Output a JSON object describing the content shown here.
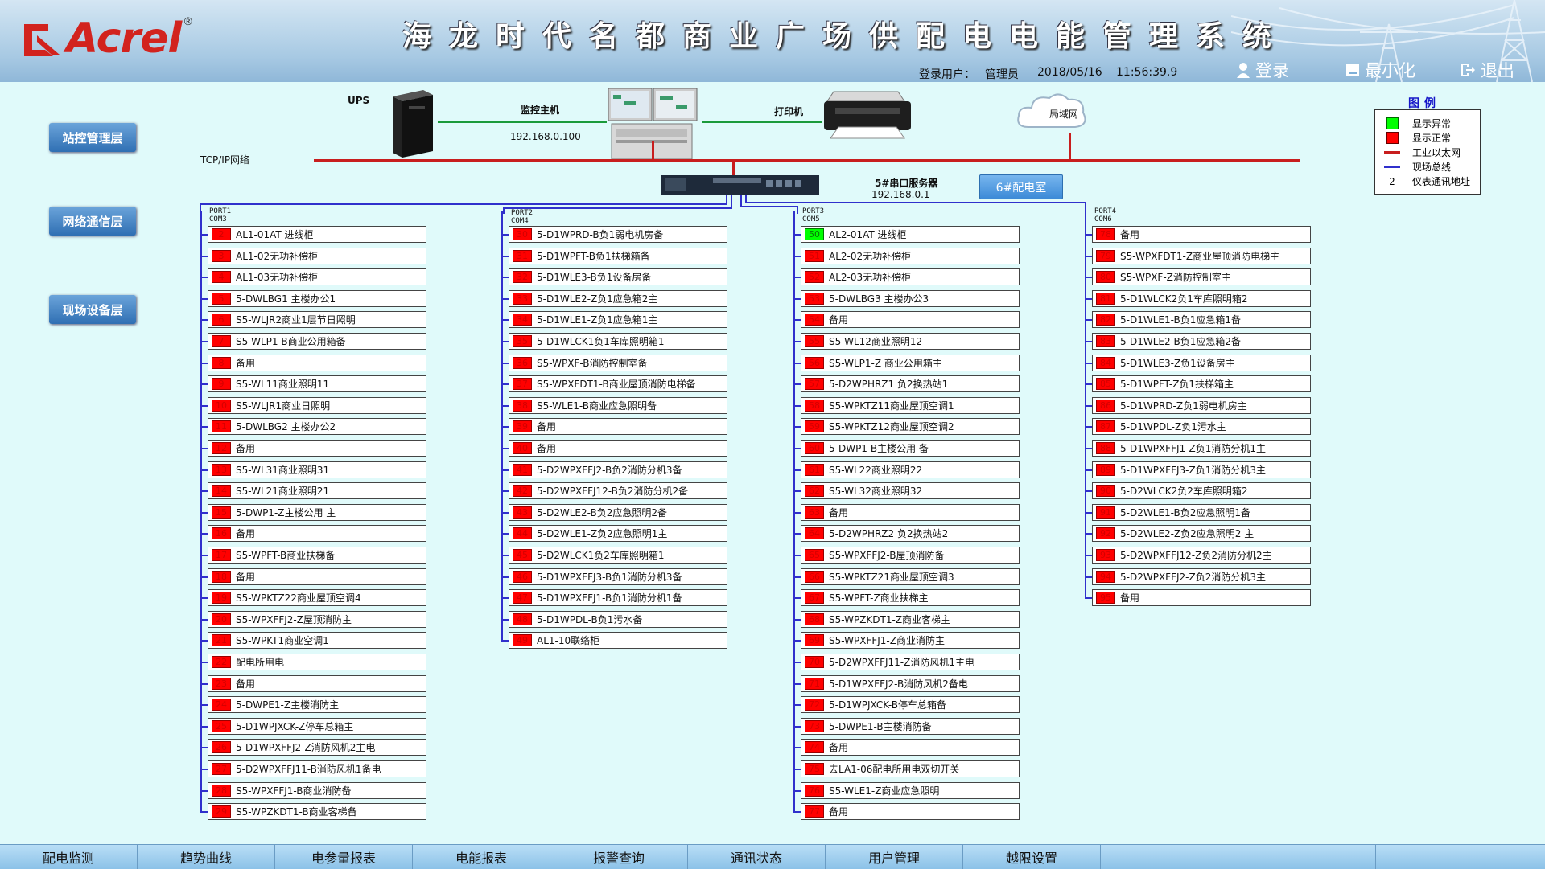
{
  "header": {
    "brand": "Acrel",
    "reg_mark": "®",
    "title": "海龙时代名都商业广场供配电电能管理系统",
    "login_label": "登录用户：",
    "user": "管理员",
    "date": "2018/05/16",
    "time": "11:56:39.9",
    "login_btn": "登录",
    "minimize_btn": "最小化",
    "exit_btn": "退出"
  },
  "layers": [
    "站控管理层",
    "网络通信层",
    "现场设备层"
  ],
  "network": {
    "ups": "UPS",
    "host_label": "监控主机",
    "host_ip": "192.168.0.100",
    "printer": "打印机",
    "lan": "局域网",
    "tcp": "TCP/IP网络",
    "server_name": "5#串口服务器",
    "server_ip": "192.168.0.1",
    "room_btn": "6#配电室"
  },
  "legend": {
    "title": "图例",
    "items": [
      {
        "label": "显示异常",
        "icon": "green-square",
        "color": "#00ff00"
      },
      {
        "label": "显示正常",
        "icon": "red-square",
        "color": "#ff0000"
      },
      {
        "label": "工业以太网",
        "icon": "red-line",
        "color": "#c81e1e"
      },
      {
        "label": "现场总线",
        "icon": "blue-line",
        "color": "#3030cc"
      },
      {
        "label": "仪表通讯地址",
        "icon": "number",
        "symbol": "2"
      }
    ]
  },
  "ports": [
    {
      "port": "PORT1",
      "com": "COM3",
      "devices": [
        {
          "num": "2",
          "name": "AL1-01AT 进线柜"
        },
        {
          "num": "3",
          "name": "AL1-02无功补偿柜"
        },
        {
          "num": "4",
          "name": "AL1-03无功补偿柜"
        },
        {
          "num": "5",
          "name": "5-DWLBG1 主楼办公1"
        },
        {
          "num": "6",
          "name": "S5-WLJR2商业1层节日照明"
        },
        {
          "num": "7",
          "name": "S5-WLP1-B商业公用箱备"
        },
        {
          "num": "8",
          "name": "备用"
        },
        {
          "num": "9",
          "name": "S5-WL11商业照明11"
        },
        {
          "num": "10",
          "name": "S5-WLJR1商业日照明"
        },
        {
          "num": "11",
          "name": "5-DWLBG2 主楼办公2"
        },
        {
          "num": "12",
          "name": "备用"
        },
        {
          "num": "13",
          "name": "S5-WL31商业照明31"
        },
        {
          "num": "14",
          "name": "S5-WL21商业照明21"
        },
        {
          "num": "15",
          "name": "5-DWP1-Z主楼公用 主"
        },
        {
          "num": "16",
          "name": "备用"
        },
        {
          "num": "17",
          "name": "S5-WPFT-B商业扶梯备"
        },
        {
          "num": "18",
          "name": "备用"
        },
        {
          "num": "19",
          "name": "S5-WPKTZ22商业屋顶空调4"
        },
        {
          "num": "20",
          "name": "S5-WPXFFJ2-Z屋顶消防主"
        },
        {
          "num": "21",
          "name": "S5-WPKT1商业空调1"
        },
        {
          "num": "22",
          "name": "配电所用电"
        },
        {
          "num": "23",
          "name": "备用"
        },
        {
          "num": "24",
          "name": "5-DWPE1-Z主楼消防主"
        },
        {
          "num": "25",
          "name": "5-D1WPJXCK-Z停车总箱主"
        },
        {
          "num": "26",
          "name": "5-D1WPXFFJ2-Z消防风机2主电"
        },
        {
          "num": "27",
          "name": "5-D2WPXFFJ11-B消防风机1备电"
        },
        {
          "num": "28",
          "name": "S5-WPXFFJ1-B商业消防备"
        },
        {
          "num": "29",
          "name": "S5-WPZKDT1-B商业客梯备"
        }
      ]
    },
    {
      "port": "PORT2",
      "com": "COM4",
      "devices": [
        {
          "num": "30",
          "name": "5-D1WPRD-B负1弱电机房备"
        },
        {
          "num": "31",
          "name": "5-D1WPFT-B负1扶梯箱备"
        },
        {
          "num": "32",
          "name": "5-D1WLE3-B负1设备房备"
        },
        {
          "num": "33",
          "name": "5-D1WLE2-Z负1应急箱2主"
        },
        {
          "num": "34",
          "name": "5-D1WLE1-Z负1应急箱1主"
        },
        {
          "num": "35",
          "name": "5-D1WLCK1负1车库照明箱1"
        },
        {
          "num": "36",
          "name": "S5-WPXF-B消防控制室备"
        },
        {
          "num": "37",
          "name": "S5-WPXFDT1-B商业屋顶消防电梯备"
        },
        {
          "num": "38",
          "name": "S5-WLE1-B商业应急照明备"
        },
        {
          "num": "39",
          "name": "备用"
        },
        {
          "num": "40",
          "name": "备用"
        },
        {
          "num": "41",
          "name": "5-D2WPXFFJ2-B负2消防分机3备"
        },
        {
          "num": "42",
          "name": "5-D2WPXFFJ12-B负2消防分机2备"
        },
        {
          "num": "43",
          "name": "5-D2WLE2-B负2应急照明2备"
        },
        {
          "num": "44",
          "name": "5-D2WLE1-Z负2应急照明1主"
        },
        {
          "num": "45",
          "name": "5-D2WLCK1负2车库照明箱1"
        },
        {
          "num": "46",
          "name": "5-D1WPXFFJ3-B负1消防分机3备"
        },
        {
          "num": "47",
          "name": "5-D1WPXFFJ1-B负1消防分机1备"
        },
        {
          "num": "48",
          "name": "5-D1WPDL-B负1污水备"
        },
        {
          "num": "49",
          "name": "AL1-10联络柜"
        }
      ]
    },
    {
      "port": "PORT3",
      "com": "COM5",
      "devices": [
        {
          "num": "50",
          "name": "AL2-01AT 进线柜",
          "ok": true
        },
        {
          "num": "51",
          "name": "AL2-02无功补偿柜"
        },
        {
          "num": "52",
          "name": "AL2-03无功补偿柜"
        },
        {
          "num": "53",
          "name": "5-DWLBG3 主楼办公3"
        },
        {
          "num": "54",
          "name": "备用"
        },
        {
          "num": "55",
          "name": "S5-WL12商业照明12"
        },
        {
          "num": "56",
          "name": "S5-WLP1-Z 商业公用箱主"
        },
        {
          "num": "57",
          "name": "5-D2WPHRZ1 负2换热站1"
        },
        {
          "num": "58",
          "name": "S5-WPKTZ11商业屋顶空调1"
        },
        {
          "num": "59",
          "name": "S5-WPKTZ12商业屋顶空调2"
        },
        {
          "num": "60",
          "name": "5-DWP1-B主楼公用 备"
        },
        {
          "num": "61",
          "name": "S5-WL22商业照明22"
        },
        {
          "num": "62",
          "name": "S5-WL32商业照明32"
        },
        {
          "num": "63",
          "name": "备用"
        },
        {
          "num": "64",
          "name": "5-D2WPHRZ2 负2换热站2"
        },
        {
          "num": "65",
          "name": "S5-WPXFFJ2-B屋顶消防备"
        },
        {
          "num": "66",
          "name": "S5-WPKTZ21商业屋顶空调3"
        },
        {
          "num": "67",
          "name": "S5-WPFT-Z商业扶梯主"
        },
        {
          "num": "68",
          "name": "S5-WPZKDT1-Z商业客梯主"
        },
        {
          "num": "69",
          "name": "S5-WPXFFJ1-Z商业消防主"
        },
        {
          "num": "70",
          "name": "5-D2WPXFFJ11-Z消防风机1主电"
        },
        {
          "num": "71",
          "name": "5-D1WPXFFJ2-B消防风机2备电"
        },
        {
          "num": "72",
          "name": "5-D1WPJXCK-B停车总箱备"
        },
        {
          "num": "73",
          "name": "5-DWPE1-B主楼消防备"
        },
        {
          "num": "74",
          "name": "备用"
        },
        {
          "num": "75",
          "name": "去LA1-06配电所用电双切开关"
        },
        {
          "num": "76",
          "name": "S5-WLE1-Z商业应急照明"
        },
        {
          "num": "77",
          "name": "备用"
        }
      ]
    },
    {
      "port": "PORT4",
      "com": "COM6",
      "devices": [
        {
          "num": "78",
          "name": "备用"
        },
        {
          "num": "79",
          "name": "S5-WPXFDT1-Z商业屋顶消防电梯主"
        },
        {
          "num": "80",
          "name": "S5-WPXF-Z消防控制室主"
        },
        {
          "num": "81",
          "name": "5-D1WLCK2负1车库照明箱2"
        },
        {
          "num": "82",
          "name": "5-D1WLE1-B负1应急箱1备"
        },
        {
          "num": "83",
          "name": "5-D1WLE2-B负1应急箱2备"
        },
        {
          "num": "84",
          "name": "5-D1WLE3-Z负1设备房主"
        },
        {
          "num": "85",
          "name": "5-D1WPFT-Z负1扶梯箱主"
        },
        {
          "num": "86",
          "name": "5-D1WPRD-Z负1弱电机房主"
        },
        {
          "num": "87",
          "name": "5-D1WPDL-Z负1污水主"
        },
        {
          "num": "88",
          "name": "5-D1WPXFFJ1-Z负1消防分机1主"
        },
        {
          "num": "89",
          "name": "5-D1WPXFFJ3-Z负1消防分机3主"
        },
        {
          "num": "90",
          "name": "5-D2WLCK2负2车库照明箱2"
        },
        {
          "num": "91",
          "name": "5-D2WLE1-B负2应急照明1备"
        },
        {
          "num": "92",
          "name": "5-D2WLE2-Z负2应急照明2 主"
        },
        {
          "num": "93",
          "name": "5-D2WPXFFJ12-Z负2消防分机2主"
        },
        {
          "num": "94",
          "name": "5-D2WPXFFJ2-Z负2消防分机3主"
        },
        {
          "num": "95",
          "name": "备用"
        }
      ]
    }
  ],
  "bottom_tabs": [
    "配电监测",
    "趋势曲线",
    "电参量报表",
    "电能报表",
    "报警查询",
    "通讯状态",
    "用户管理",
    "越限设置"
  ]
}
